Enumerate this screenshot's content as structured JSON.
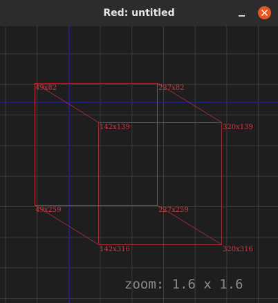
{
  "window": {
    "title": "Red: untitled",
    "minimize_icon": "minimize-icon",
    "close_icon": "close-x-icon",
    "close_color": "#e95420"
  },
  "canvas": {
    "background": "#1e1e1e",
    "grid_color": "#3c3c3c",
    "guide_color": "#1a1aa0",
    "shape_color": "#c9303c",
    "points": {
      "p1": "49x82",
      "p2": "227x82",
      "p3": "142x139",
      "p4": "320x139",
      "p5": "49x259",
      "p6": "227x259",
      "p7": "142x316",
      "p8": "320x316"
    },
    "zoom": "zoom: 1.6 x 1.6"
  }
}
